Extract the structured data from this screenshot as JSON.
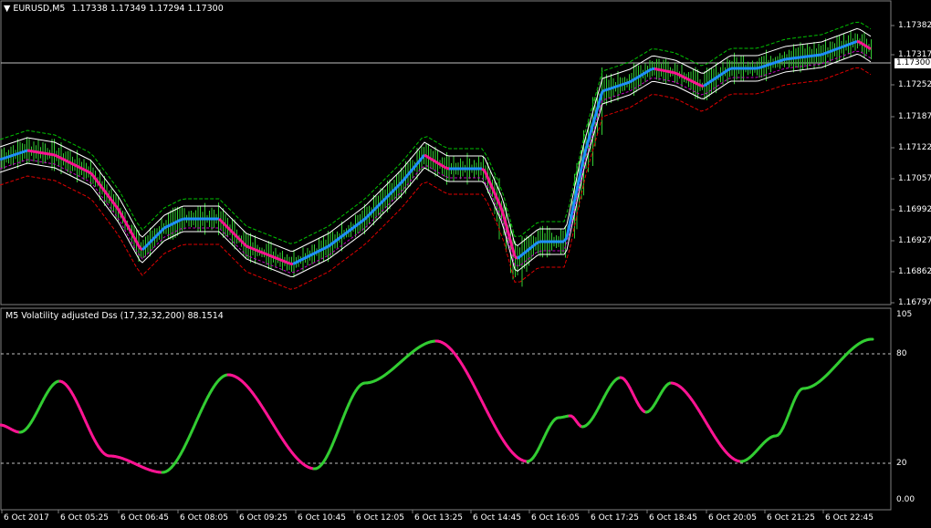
{
  "symbol_header": {
    "symbol": "EURUSD,M5",
    "open": "1.17338",
    "high": "1.17349",
    "low": "1.17294",
    "close": "1.17300"
  },
  "price_axis": {
    "ticks": [
      "1.17382",
      "1.17317",
      "1.17252",
      "1.17187",
      "1.17122",
      "1.17057",
      "1.16992",
      "1.16927",
      "1.16862",
      "1.16797"
    ],
    "current_price": "1.17300"
  },
  "indicator": {
    "title": "M5 Volatility adjusted Dss (17,32,32,200) 88.1514",
    "levels": [
      "105",
      "80",
      "20",
      "0.00"
    ],
    "level_values": [
      105,
      80,
      20,
      0
    ]
  },
  "time_axis": {
    "ticks": [
      "6 Oct 2017",
      "6 Oct 05:25",
      "6 Oct 06:45",
      "6 Oct 08:05",
      "6 Oct 09:25",
      "6 Oct 10:45",
      "6 Oct 12:05",
      "6 Oct 13:25",
      "6 Oct 14:45",
      "6 Oct 16:05",
      "6 Oct 17:25",
      "6 Oct 18:45",
      "6 Oct 20:05",
      "6 Oct 21:25",
      "6 Oct 22:45"
    ]
  },
  "colors": {
    "background": "#000000",
    "bars": "#32cd32",
    "ma_up": "#1e90ff",
    "ma_down": "#ff1493",
    "band": "#ffffff",
    "upper_channel": "#00c000",
    "lower_channel": "#e00000",
    "mid_channel": "#c000c0",
    "dss_up": "#32cd32",
    "dss_down": "#ff1493",
    "grid": "#808080"
  },
  "chart_data": [
    {
      "type": "line",
      "title": "EURUSD,M5",
      "ylim": [
        1.16797,
        1.17382
      ],
      "x": [
        "6 Oct 2017",
        "6 Oct 05:25",
        "6 Oct 06:45",
        "6 Oct 08:05",
        "6 Oct 09:25",
        "6 Oct 10:45",
        "6 Oct 12:05",
        "6 Oct 13:25",
        "6 Oct 14:45",
        "6 Oct 16:05",
        "6 Oct 17:25",
        "6 Oct 18:45",
        "6 Oct 20:05",
        "6 Oct 21:25",
        "6 Oct 22:45"
      ],
      "series": [
        {
          "values": [
            1.1713,
            1.1709,
            1.1694,
            1.1697,
            1.1691,
            1.169,
            1.17,
            1.171,
            1.1707,
            1.1691,
            1.1727,
            1.1727,
            1.173,
            1.1731,
            1.1733
          ]
        }
      ]
    },
    {
      "type": "line",
      "title": "M5 Volatility adjusted Dss (17,32,32,200) 88.1514",
      "ylim": [
        0,
        105
      ],
      "x": [
        "6 Oct 2017",
        "6 Oct 05:25",
        "6 Oct 06:45",
        "6 Oct 08:05",
        "6 Oct 09:25",
        "6 Oct 10:45",
        "6 Oct 12:05",
        "6 Oct 13:25",
        "6 Oct 14:45",
        "6 Oct 16:05",
        "6 Oct 17:25",
        "6 Oct 18:45",
        "6 Oct 20:05",
        "6 Oct 21:25",
        "6 Oct 22:45"
      ],
      "series": [
        {
          "values": [
            45,
            66,
            35,
            17,
            58,
            30,
            17,
            55,
            88,
            45,
            35,
            48,
            40,
            22,
            38,
            55,
            82,
            88,
            20,
            22,
            40,
            60,
            90
          ]
        }
      ]
    }
  ]
}
